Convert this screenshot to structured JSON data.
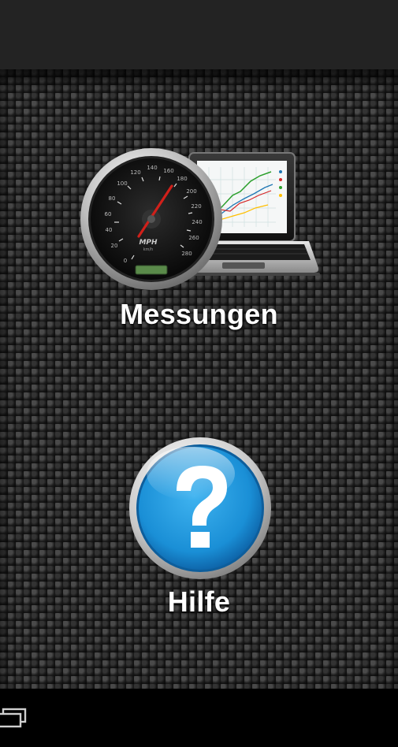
{
  "menu": {
    "items": [
      {
        "label": "Messungen",
        "icon": "speedometer-laptop-icon"
      },
      {
        "label": "Hilfe",
        "icon": "help-question-icon"
      }
    ]
  },
  "gauge": {
    "unit": "MPH",
    "sub_unit": "km/h",
    "ticks": [
      "0",
      "20",
      "40",
      "60",
      "80",
      "100",
      "120",
      "140",
      "160",
      "180",
      "200",
      "220",
      "240",
      "260",
      "280"
    ]
  },
  "colors": {
    "background": "#111111",
    "help_blue": "#1a8fd6",
    "needle": "#d0201a",
    "label": "#ffffff"
  }
}
